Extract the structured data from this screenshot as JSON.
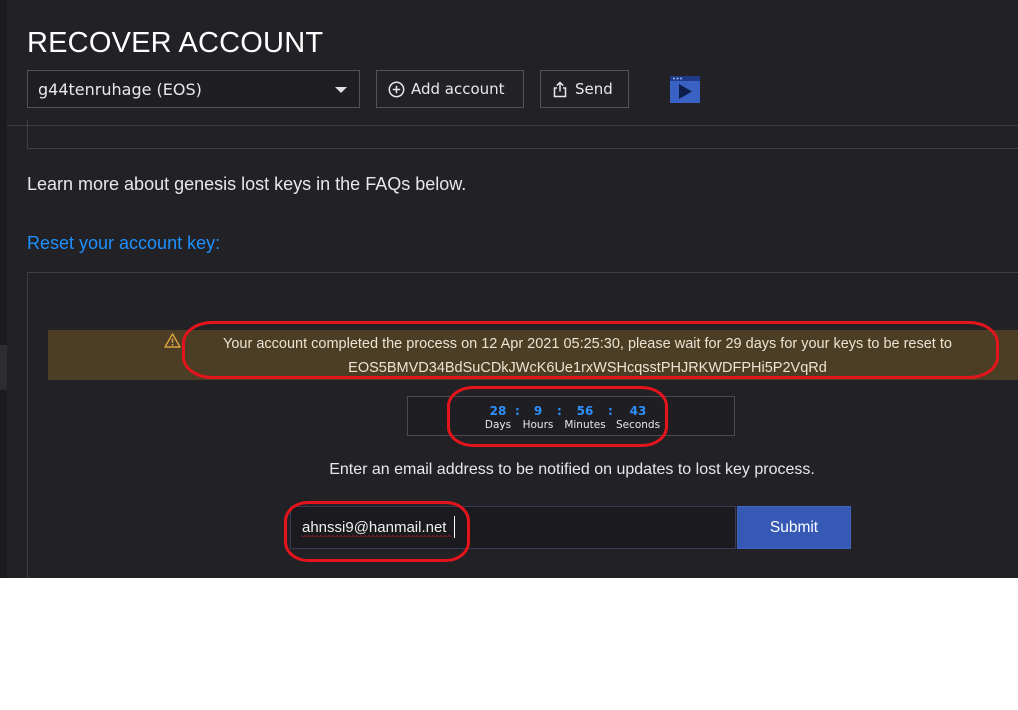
{
  "page": {
    "title": "RECOVER ACCOUNT"
  },
  "header": {
    "account_select": {
      "value": "g44tenruhage (EOS)",
      "icon": "chevron-down-icon"
    },
    "add_account_label": "Add account",
    "send_label": "Send",
    "icons": [
      "plus-circle-icon",
      "share-icon",
      "video-play-icon"
    ]
  },
  "main": {
    "learn_text": "Learn more about genesis lost keys in the FAQs below.",
    "reset_heading": "Reset your account key:",
    "alert": {
      "icon": "warning-icon",
      "line1": "Your account completed the process on 12 Apr 2021 05:25:30, please wait for 29 days for your keys to be reset to",
      "line2": "EOS5BMVD34BdSuCDkJWcK6Ue1rxWSHcqsstPHJRKWDFPHi5P2VqRd"
    },
    "countdown": {
      "separator": ":",
      "days": {
        "value": "28",
        "label": "Days"
      },
      "hours": {
        "value": "9",
        "label": "Hours"
      },
      "minutes": {
        "value": "56",
        "label": "Minutes"
      },
      "seconds": {
        "value": "43",
        "label": "Seconds"
      }
    },
    "notify_text": "Enter an email address to be notified on updates to lost key process.",
    "email": {
      "value": "ahnssi9@hanmail.net"
    },
    "submit_label": "Submit"
  },
  "colors": {
    "background": "#222226",
    "accent_link": "#1e90ff",
    "countdown_number": "#2e8fff",
    "alert_background": "#4b3e25",
    "submit_button": "#3559b4",
    "annotation_red": "#e3141c"
  }
}
